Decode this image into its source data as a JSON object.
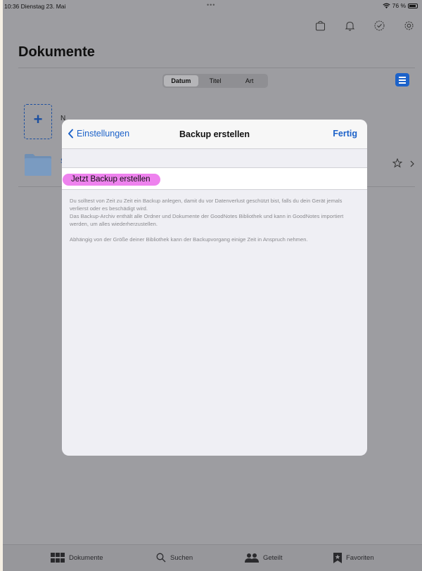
{
  "status_bar": {
    "time_date": "10:36  Dienstag 23. Mai",
    "dots": "•••",
    "battery": "76 %"
  },
  "page": {
    "title": "Dokumente"
  },
  "sort": {
    "options": [
      "Datum",
      "Titel",
      "Art"
    ],
    "selected": "Datum"
  },
  "items": {
    "new_label_partial": "N",
    "folder_label_partial": "S"
  },
  "modal": {
    "back_label": "Einstellungen",
    "title": "Backup erstellen",
    "done_label": "Fertig",
    "action_label": "Jetzt Backup erstellen",
    "footer_line1": "Du solltest von Zeit zu Zeit ein Backup anlegen, damit du vor Datenverlust geschützt bist, falls du dein Gerät jemals verlierst oder es beschädigt wird.",
    "footer_line2": "Das Backup-Archiv enthält alle Ordner und Dokumente der GoodNotes Bibliothek und kann in GoodNotes importiert werden, um alles wiederherzustellen.",
    "footer_line3": "Abhängig von der Größe deiner Bibliothek kann der Backupvorgang einige Zeit in Anspruch nehmen."
  },
  "tabbar": {
    "tabs": [
      {
        "label": "Dokumente",
        "icon": "grid-icon"
      },
      {
        "label": "Suchen",
        "icon": "search-icon"
      },
      {
        "label": "Geteilt",
        "icon": "people-icon"
      },
      {
        "label": "Favoriten",
        "icon": "bookmark-star-icon"
      }
    ]
  },
  "colors": {
    "accent": "#1c62c9",
    "highlight": "#ee82ee",
    "dimmed_background": "#9d9da1"
  }
}
